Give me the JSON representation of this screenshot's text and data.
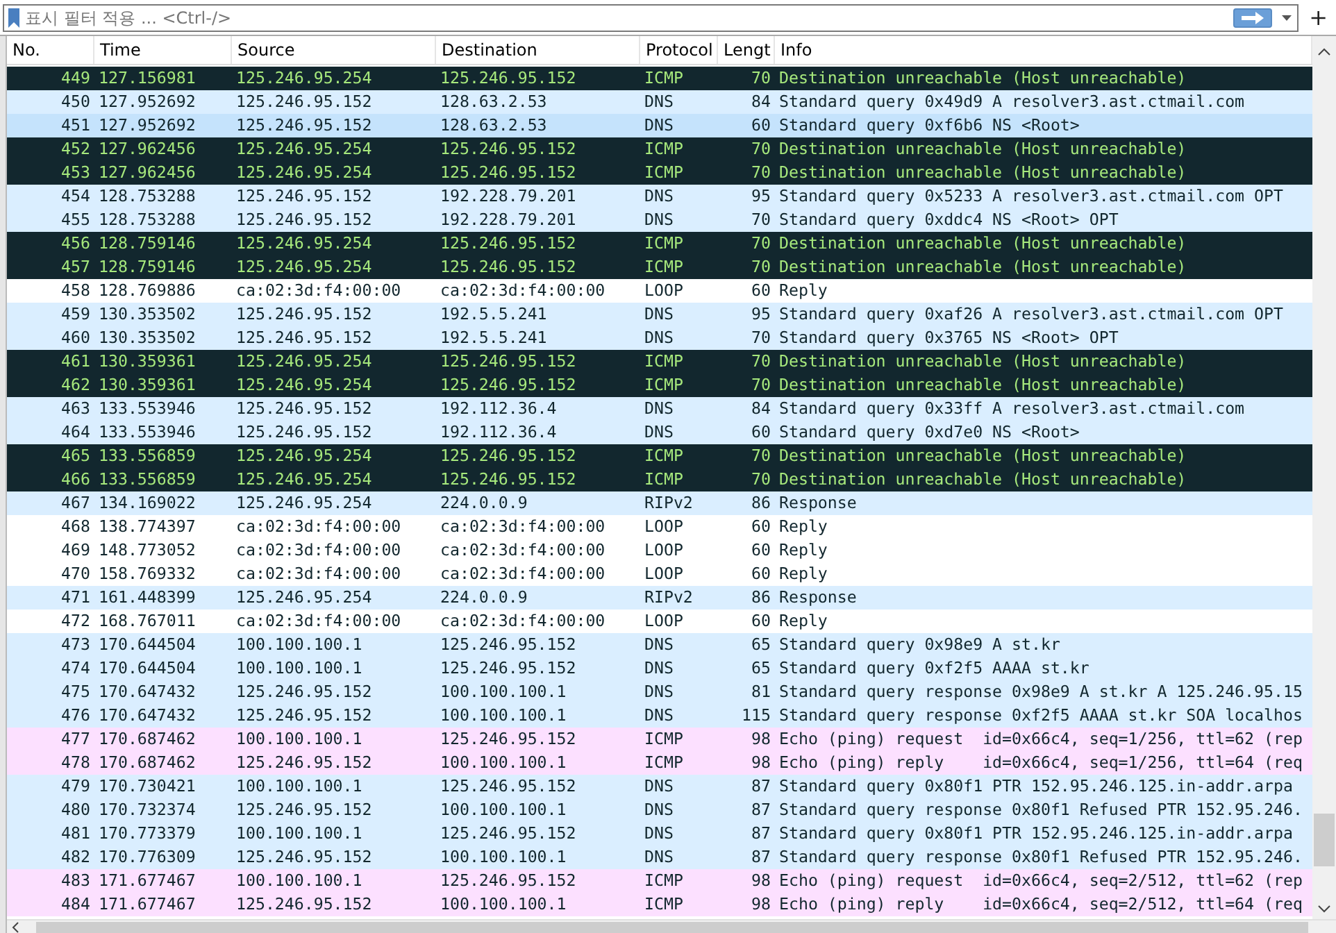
{
  "filter_bar": {
    "placeholder": "표시 필터 적용 ... <Ctrl-/>",
    "add_label": "+"
  },
  "table": {
    "columns": [
      "No.",
      "Time",
      "Source",
      "Destination",
      "Protocol",
      "Lengt",
      "Info"
    ],
    "rows": [
      {
        "kind": "error",
        "selected": false,
        "cells": [
          "449",
          "127.156981",
          "125.246.95.254",
          "125.246.95.152",
          "ICMP",
          "70",
          "Destination unreachable (Host unreachable)"
        ]
      },
      {
        "kind": "udp",
        "selected": false,
        "cells": [
          "450",
          "127.952692",
          "125.246.95.152",
          "128.63.2.53",
          "DNS",
          "84",
          "Standard query 0x49d9 A resolver3.ast.ctmail.com"
        ]
      },
      {
        "kind": "udp",
        "selected": true,
        "cells": [
          "451",
          "127.952692",
          "125.246.95.152",
          "128.63.2.53",
          "DNS",
          "60",
          "Standard query 0xf6b6 NS <Root>"
        ]
      },
      {
        "kind": "error",
        "selected": false,
        "cells": [
          "452",
          "127.962456",
          "125.246.95.254",
          "125.246.95.152",
          "ICMP",
          "70",
          "Destination unreachable (Host unreachable)"
        ]
      },
      {
        "kind": "error",
        "selected": false,
        "cells": [
          "453",
          "127.962456",
          "125.246.95.254",
          "125.246.95.152",
          "ICMP",
          "70",
          "Destination unreachable (Host unreachable)"
        ]
      },
      {
        "kind": "udp",
        "selected": false,
        "cells": [
          "454",
          "128.753288",
          "125.246.95.152",
          "192.228.79.201",
          "DNS",
          "95",
          "Standard query 0x5233 A resolver3.ast.ctmail.com OPT"
        ]
      },
      {
        "kind": "udp",
        "selected": false,
        "cells": [
          "455",
          "128.753288",
          "125.246.95.152",
          "192.228.79.201",
          "DNS",
          "70",
          "Standard query 0xddc4 NS <Root> OPT"
        ]
      },
      {
        "kind": "error",
        "selected": false,
        "cells": [
          "456",
          "128.759146",
          "125.246.95.254",
          "125.246.95.152",
          "ICMP",
          "70",
          "Destination unreachable (Host unreachable)"
        ]
      },
      {
        "kind": "error",
        "selected": false,
        "cells": [
          "457",
          "128.759146",
          "125.246.95.254",
          "125.246.95.152",
          "ICMP",
          "70",
          "Destination unreachable (Host unreachable)"
        ]
      },
      {
        "kind": "plain",
        "selected": false,
        "cells": [
          "458",
          "128.769886",
          "ca:02:3d:f4:00:00",
          "ca:02:3d:f4:00:00",
          "LOOP",
          "60",
          "Reply"
        ]
      },
      {
        "kind": "udp",
        "selected": false,
        "cells": [
          "459",
          "130.353502",
          "125.246.95.152",
          "192.5.5.241",
          "DNS",
          "95",
          "Standard query 0xaf26 A resolver3.ast.ctmail.com OPT"
        ]
      },
      {
        "kind": "udp",
        "selected": false,
        "cells": [
          "460",
          "130.353502",
          "125.246.95.152",
          "192.5.5.241",
          "DNS",
          "70",
          "Standard query 0x3765 NS <Root> OPT"
        ]
      },
      {
        "kind": "error",
        "selected": false,
        "cells": [
          "461",
          "130.359361",
          "125.246.95.254",
          "125.246.95.152",
          "ICMP",
          "70",
          "Destination unreachable (Host unreachable)"
        ]
      },
      {
        "kind": "error",
        "selected": false,
        "cells": [
          "462",
          "130.359361",
          "125.246.95.254",
          "125.246.95.152",
          "ICMP",
          "70",
          "Destination unreachable (Host unreachable)"
        ]
      },
      {
        "kind": "udp",
        "selected": false,
        "cells": [
          "463",
          "133.553946",
          "125.246.95.152",
          "192.112.36.4",
          "DNS",
          "84",
          "Standard query 0x33ff A resolver3.ast.ctmail.com"
        ]
      },
      {
        "kind": "udp",
        "selected": false,
        "cells": [
          "464",
          "133.553946",
          "125.246.95.152",
          "192.112.36.4",
          "DNS",
          "60",
          "Standard query 0xd7e0 NS <Root>"
        ]
      },
      {
        "kind": "error",
        "selected": false,
        "cells": [
          "465",
          "133.556859",
          "125.246.95.254",
          "125.246.95.152",
          "ICMP",
          "70",
          "Destination unreachable (Host unreachable)"
        ]
      },
      {
        "kind": "error",
        "selected": false,
        "cells": [
          "466",
          "133.556859",
          "125.246.95.254",
          "125.246.95.152",
          "ICMP",
          "70",
          "Destination unreachable (Host unreachable)"
        ]
      },
      {
        "kind": "udp",
        "selected": false,
        "cells": [
          "467",
          "134.169022",
          "125.246.95.254",
          "224.0.0.9",
          "RIPv2",
          "86",
          "Response"
        ]
      },
      {
        "kind": "plain",
        "selected": false,
        "cells": [
          "468",
          "138.774397",
          "ca:02:3d:f4:00:00",
          "ca:02:3d:f4:00:00",
          "LOOP",
          "60",
          "Reply"
        ]
      },
      {
        "kind": "plain",
        "selected": false,
        "cells": [
          "469",
          "148.773052",
          "ca:02:3d:f4:00:00",
          "ca:02:3d:f4:00:00",
          "LOOP",
          "60",
          "Reply"
        ]
      },
      {
        "kind": "plain",
        "selected": false,
        "cells": [
          "470",
          "158.769332",
          "ca:02:3d:f4:00:00",
          "ca:02:3d:f4:00:00",
          "LOOP",
          "60",
          "Reply"
        ]
      },
      {
        "kind": "udp",
        "selected": false,
        "cells": [
          "471",
          "161.448399",
          "125.246.95.254",
          "224.0.0.9",
          "RIPv2",
          "86",
          "Response"
        ]
      },
      {
        "kind": "plain",
        "selected": false,
        "cells": [
          "472",
          "168.767011",
          "ca:02:3d:f4:00:00",
          "ca:02:3d:f4:00:00",
          "LOOP",
          "60",
          "Reply"
        ]
      },
      {
        "kind": "udp",
        "selected": false,
        "cells": [
          "473",
          "170.644504",
          "100.100.100.1",
          "125.246.95.152",
          "DNS",
          "65",
          "Standard query 0x98e9 A st.kr"
        ]
      },
      {
        "kind": "udp",
        "selected": false,
        "cells": [
          "474",
          "170.644504",
          "100.100.100.1",
          "125.246.95.152",
          "DNS",
          "65",
          "Standard query 0xf2f5 AAAA st.kr"
        ]
      },
      {
        "kind": "udp",
        "selected": false,
        "cells": [
          "475",
          "170.647432",
          "125.246.95.152",
          "100.100.100.1",
          "DNS",
          "81",
          "Standard query response 0x98e9 A st.kr A 125.246.95.15"
        ]
      },
      {
        "kind": "udp",
        "selected": false,
        "cells": [
          "476",
          "170.647432",
          "125.246.95.152",
          "100.100.100.1",
          "DNS",
          "115",
          "Standard query response 0xf2f5 AAAA st.kr SOA localhos"
        ]
      },
      {
        "kind": "icmp",
        "selected": false,
        "cells": [
          "477",
          "170.687462",
          "100.100.100.1",
          "125.246.95.152",
          "ICMP",
          "98",
          "Echo (ping) request  id=0x66c4, seq=1/256, ttl=62 (rep"
        ]
      },
      {
        "kind": "icmp",
        "selected": false,
        "cells": [
          "478",
          "170.687462",
          "125.246.95.152",
          "100.100.100.1",
          "ICMP",
          "98",
          "Echo (ping) reply    id=0x66c4, seq=1/256, ttl=64 (req"
        ]
      },
      {
        "kind": "udp",
        "selected": false,
        "cells": [
          "479",
          "170.730421",
          "100.100.100.1",
          "125.246.95.152",
          "DNS",
          "87",
          "Standard query 0x80f1 PTR 152.95.246.125.in-addr.arpa"
        ]
      },
      {
        "kind": "udp",
        "selected": false,
        "cells": [
          "480",
          "170.732374",
          "125.246.95.152",
          "100.100.100.1",
          "DNS",
          "87",
          "Standard query response 0x80f1 Refused PTR 152.95.246."
        ]
      },
      {
        "kind": "udp",
        "selected": false,
        "cells": [
          "481",
          "170.773379",
          "100.100.100.1",
          "125.246.95.152",
          "DNS",
          "87",
          "Standard query 0x80f1 PTR 152.95.246.125.in-addr.arpa"
        ]
      },
      {
        "kind": "udp",
        "selected": false,
        "cells": [
          "482",
          "170.776309",
          "125.246.95.152",
          "100.100.100.1",
          "DNS",
          "87",
          "Standard query response 0x80f1 Refused PTR 152.95.246."
        ]
      },
      {
        "kind": "icmp",
        "selected": false,
        "cells": [
          "483",
          "171.677467",
          "100.100.100.1",
          "125.246.95.152",
          "ICMP",
          "98",
          "Echo (ping) request  id=0x66c4, seq=2/512, ttl=62 (rep"
        ]
      },
      {
        "kind": "icmp",
        "selected": false,
        "cells": [
          "484",
          "171.677467",
          "125.246.95.152",
          "100.100.100.1",
          "ICMP",
          "98",
          "Echo (ping) reply    id=0x66c4, seq=2/512, ttl=64 (req"
        ]
      }
    ]
  }
}
